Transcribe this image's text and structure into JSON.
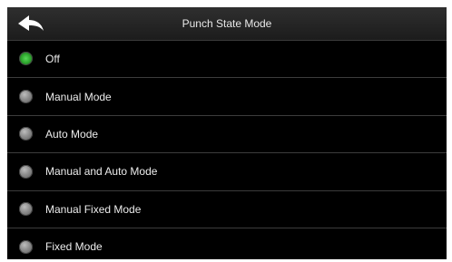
{
  "header": {
    "title": "Punch State Mode",
    "back_icon": "back-arrow-icon"
  },
  "options": [
    {
      "label": "Off",
      "selected": true
    },
    {
      "label": "Manual Mode",
      "selected": false
    },
    {
      "label": "Auto Mode",
      "selected": false
    },
    {
      "label": "Manual and Auto Mode",
      "selected": false
    },
    {
      "label": "Manual Fixed Mode",
      "selected": false
    },
    {
      "label": "Fixed Mode",
      "selected": false
    }
  ],
  "colors": {
    "background": "#000000",
    "header": "#262626",
    "selected_radio": "#3cc43c",
    "unselected_radio": "#8a8a8a",
    "divider": "#3c3c3c",
    "text": "#ececec"
  }
}
